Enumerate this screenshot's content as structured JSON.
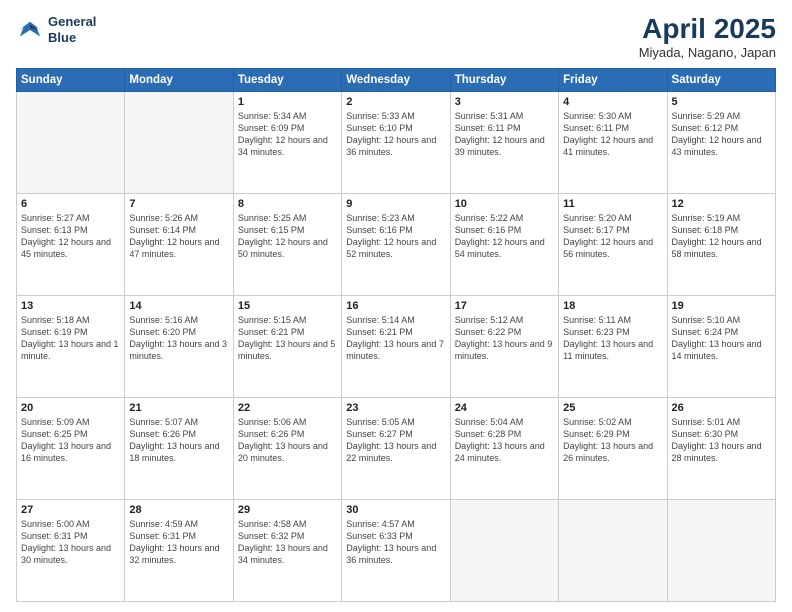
{
  "header": {
    "logo_line1": "General",
    "logo_line2": "Blue",
    "title": "April 2025",
    "subtitle": "Miyada, Nagano, Japan"
  },
  "days_of_week": [
    "Sunday",
    "Monday",
    "Tuesday",
    "Wednesday",
    "Thursday",
    "Friday",
    "Saturday"
  ],
  "weeks": [
    [
      {
        "day": "",
        "info": ""
      },
      {
        "day": "",
        "info": ""
      },
      {
        "day": "1",
        "info": "Sunrise: 5:34 AM\nSunset: 6:09 PM\nDaylight: 12 hours\nand 34 minutes."
      },
      {
        "day": "2",
        "info": "Sunrise: 5:33 AM\nSunset: 6:10 PM\nDaylight: 12 hours\nand 36 minutes."
      },
      {
        "day": "3",
        "info": "Sunrise: 5:31 AM\nSunset: 6:11 PM\nDaylight: 12 hours\nand 39 minutes."
      },
      {
        "day": "4",
        "info": "Sunrise: 5:30 AM\nSunset: 6:11 PM\nDaylight: 12 hours\nand 41 minutes."
      },
      {
        "day": "5",
        "info": "Sunrise: 5:29 AM\nSunset: 6:12 PM\nDaylight: 12 hours\nand 43 minutes."
      }
    ],
    [
      {
        "day": "6",
        "info": "Sunrise: 5:27 AM\nSunset: 6:13 PM\nDaylight: 12 hours\nand 45 minutes."
      },
      {
        "day": "7",
        "info": "Sunrise: 5:26 AM\nSunset: 6:14 PM\nDaylight: 12 hours\nand 47 minutes."
      },
      {
        "day": "8",
        "info": "Sunrise: 5:25 AM\nSunset: 6:15 PM\nDaylight: 12 hours\nand 50 minutes."
      },
      {
        "day": "9",
        "info": "Sunrise: 5:23 AM\nSunset: 6:16 PM\nDaylight: 12 hours\nand 52 minutes."
      },
      {
        "day": "10",
        "info": "Sunrise: 5:22 AM\nSunset: 6:16 PM\nDaylight: 12 hours\nand 54 minutes."
      },
      {
        "day": "11",
        "info": "Sunrise: 5:20 AM\nSunset: 6:17 PM\nDaylight: 12 hours\nand 56 minutes."
      },
      {
        "day": "12",
        "info": "Sunrise: 5:19 AM\nSunset: 6:18 PM\nDaylight: 12 hours\nand 58 minutes."
      }
    ],
    [
      {
        "day": "13",
        "info": "Sunrise: 5:18 AM\nSunset: 6:19 PM\nDaylight: 13 hours\nand 1 minute."
      },
      {
        "day": "14",
        "info": "Sunrise: 5:16 AM\nSunset: 6:20 PM\nDaylight: 13 hours\nand 3 minutes."
      },
      {
        "day": "15",
        "info": "Sunrise: 5:15 AM\nSunset: 6:21 PM\nDaylight: 13 hours\nand 5 minutes."
      },
      {
        "day": "16",
        "info": "Sunrise: 5:14 AM\nSunset: 6:21 PM\nDaylight: 13 hours\nand 7 minutes."
      },
      {
        "day": "17",
        "info": "Sunrise: 5:12 AM\nSunset: 6:22 PM\nDaylight: 13 hours\nand 9 minutes."
      },
      {
        "day": "18",
        "info": "Sunrise: 5:11 AM\nSunset: 6:23 PM\nDaylight: 13 hours\nand 11 minutes."
      },
      {
        "day": "19",
        "info": "Sunrise: 5:10 AM\nSunset: 6:24 PM\nDaylight: 13 hours\nand 14 minutes."
      }
    ],
    [
      {
        "day": "20",
        "info": "Sunrise: 5:09 AM\nSunset: 6:25 PM\nDaylight: 13 hours\nand 16 minutes."
      },
      {
        "day": "21",
        "info": "Sunrise: 5:07 AM\nSunset: 6:26 PM\nDaylight: 13 hours\nand 18 minutes."
      },
      {
        "day": "22",
        "info": "Sunrise: 5:06 AM\nSunset: 6:26 PM\nDaylight: 13 hours\nand 20 minutes."
      },
      {
        "day": "23",
        "info": "Sunrise: 5:05 AM\nSunset: 6:27 PM\nDaylight: 13 hours\nand 22 minutes."
      },
      {
        "day": "24",
        "info": "Sunrise: 5:04 AM\nSunset: 6:28 PM\nDaylight: 13 hours\nand 24 minutes."
      },
      {
        "day": "25",
        "info": "Sunrise: 5:02 AM\nSunset: 6:29 PM\nDaylight: 13 hours\nand 26 minutes."
      },
      {
        "day": "26",
        "info": "Sunrise: 5:01 AM\nSunset: 6:30 PM\nDaylight: 13 hours\nand 28 minutes."
      }
    ],
    [
      {
        "day": "27",
        "info": "Sunrise: 5:00 AM\nSunset: 6:31 PM\nDaylight: 13 hours\nand 30 minutes."
      },
      {
        "day": "28",
        "info": "Sunrise: 4:59 AM\nSunset: 6:31 PM\nDaylight: 13 hours\nand 32 minutes."
      },
      {
        "day": "29",
        "info": "Sunrise: 4:58 AM\nSunset: 6:32 PM\nDaylight: 13 hours\nand 34 minutes."
      },
      {
        "day": "30",
        "info": "Sunrise: 4:57 AM\nSunset: 6:33 PM\nDaylight: 13 hours\nand 36 minutes."
      },
      {
        "day": "",
        "info": ""
      },
      {
        "day": "",
        "info": ""
      },
      {
        "day": "",
        "info": ""
      }
    ]
  ]
}
